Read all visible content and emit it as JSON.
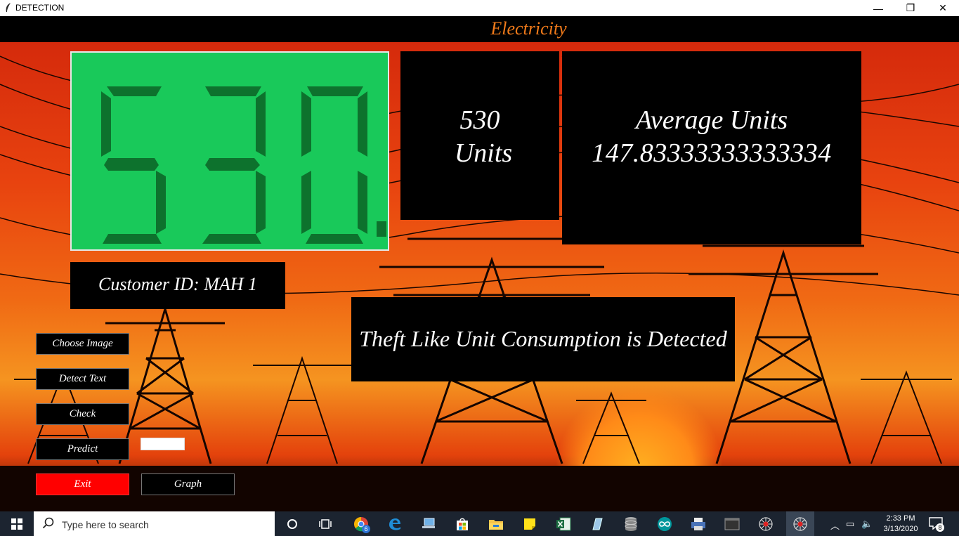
{
  "window": {
    "title": "DETECTION",
    "minimize": "—",
    "restore": "❐",
    "close": "✕"
  },
  "header": {
    "title": "Electricity"
  },
  "meter": {
    "digits": "530."
  },
  "reading": {
    "value": "530",
    "unit_label": "Units"
  },
  "average": {
    "label": "Average Units",
    "value": "147.83333333333334"
  },
  "customer": {
    "text": "Customer ID: MAH 1"
  },
  "result": {
    "text": "Theft Like Unit Consumption is Detected"
  },
  "buttons": {
    "choose_image": "Choose Image",
    "detect_text": "Detect Text",
    "check": "Check",
    "predict": "Predict",
    "exit": "Exit",
    "graph": "Graph"
  },
  "predict_value": "",
  "taskbar": {
    "search_placeholder": "Type here to search",
    "time": "2:33 PM",
    "date": "3/13/2020",
    "notification_count": "8",
    "chrome_badge": "6",
    "icons": [
      "cortana-icon",
      "task-view-icon",
      "chrome-icon",
      "edge-icon",
      "network-share-icon",
      "store-icon",
      "file-explorer-icon",
      "sticky-notes-icon",
      "excel-icon",
      "app-icon",
      "database-icon",
      "arduino-icon",
      "printer-icon",
      "terminal-icon",
      "spider-app-icon",
      "spider-app-active-icon"
    ]
  },
  "colors": {
    "accent": "#f07a1a",
    "exit": "#ff0000",
    "meter_green": "#19c95a",
    "digit": "#0d6b2a"
  }
}
